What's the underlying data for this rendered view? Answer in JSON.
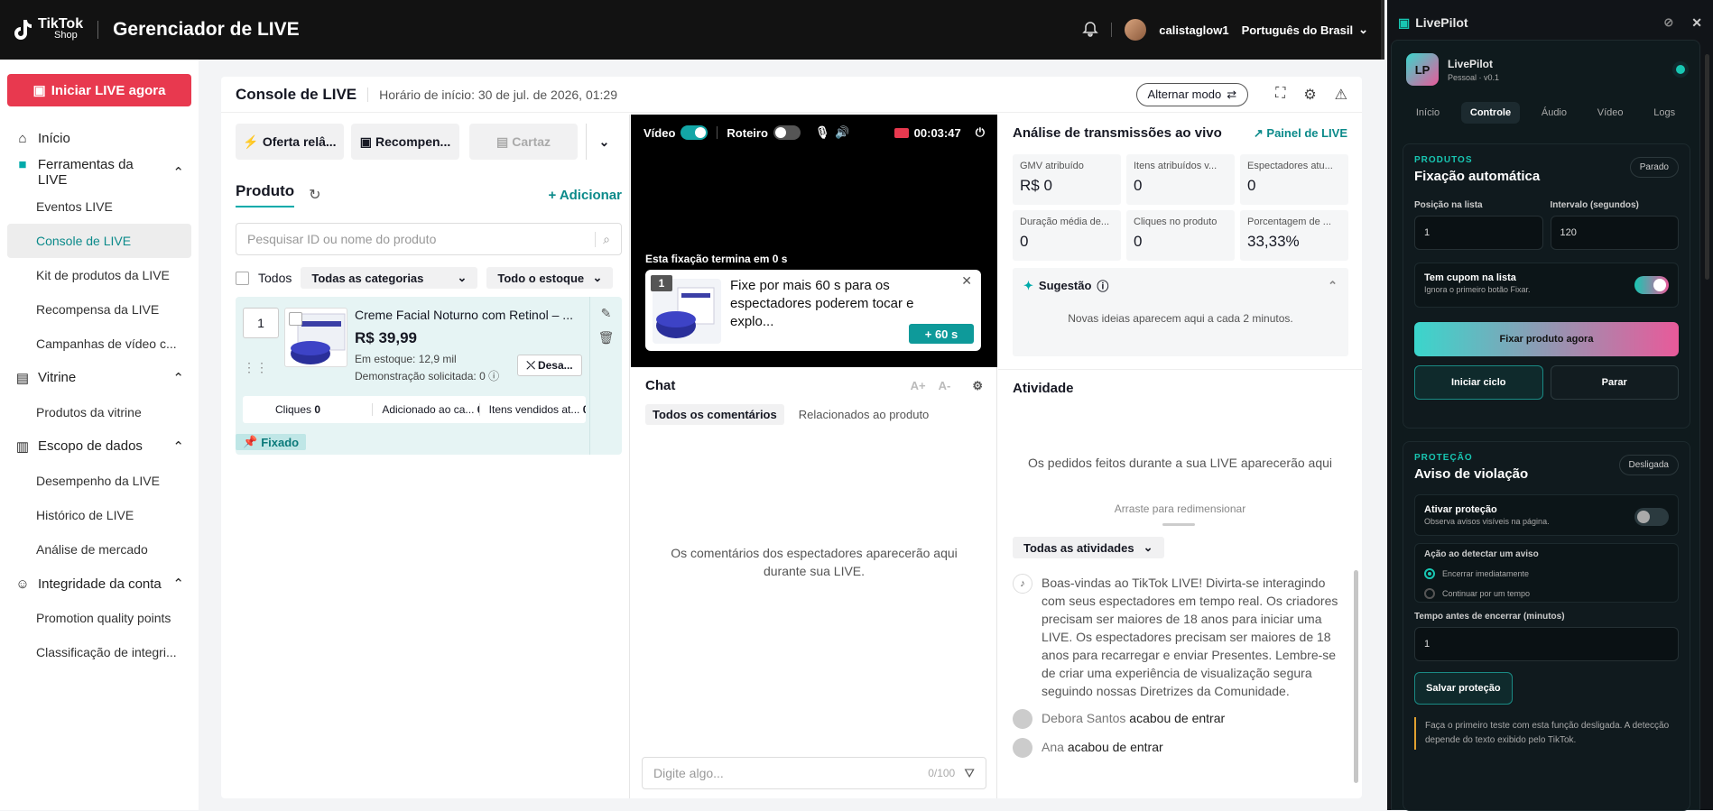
{
  "header": {
    "brand_top": "TikTok",
    "brand_bottom": "Shop",
    "title": "Gerenciador de LIVE",
    "username": "calistaglow1",
    "language": "Português do Brasil"
  },
  "sidebar": {
    "live_button": "Iniciar LIVE agora",
    "home": "Início",
    "groups": [
      {
        "label": "Ferramentas da LIVE",
        "items": [
          "Eventos LIVE",
          "Console de LIVE",
          "Kit de produtos da LIVE",
          "Recompensa da LIVE",
          "Campanhas de vídeo c..."
        ]
      },
      {
        "label": "Vitrine",
        "items": [
          "Produtos da vitrine"
        ]
      },
      {
        "label": "Escopo de dados",
        "items": [
          "Desempenho da LIVE",
          "Histórico de LIVE",
          "Análise de mercado"
        ]
      },
      {
        "label": "Integridade da conta",
        "items": [
          "Promotion quality points",
          "Classificação de integri..."
        ]
      }
    ]
  },
  "console": {
    "title": "Console de LIVE",
    "start_time": "Horário de início: 30 de jul. de 2026, 01:29",
    "mode_button": "Alternar modo"
  },
  "products": {
    "tools": [
      "Oferta relâ...",
      "Recompen...",
      "Cartaz"
    ],
    "tab": "Produto",
    "add": "Adicionar",
    "search_placeholder": "Pesquisar ID ou nome do produto",
    "all": "Todos",
    "category": "Todas as categorias",
    "stock": "Todo o estoque",
    "item": {
      "qty": "1",
      "name": "Creme Facial Noturno com Retinol – ...",
      "price": "R$ 39,99",
      "stock": "Em estoque: 12,9 mil",
      "demo": "Demonstração solicitada: 0",
      "unpin": "Desa...",
      "clicks_label": "Cliques",
      "clicks": "0",
      "added_label": "Adicionado ao ca...",
      "added": "0",
      "sold_label": "Itens vendidos at...",
      "sold": "0",
      "pinned": "Fixado"
    }
  },
  "video": {
    "video_label": "Vídeo",
    "script_label": "Roteiro",
    "timer": "00:03:47",
    "pin_ends": "Esta fixação termina em 0 s",
    "pin_index": "1",
    "pin_text": "Fixe por mais 60 s para os espectadores poderem tocar e explo...",
    "pin_plus": "+ 60 s"
  },
  "chat": {
    "title": "Chat",
    "font_up": "A+",
    "font_down": "A-",
    "tab_all": "Todos os comentários",
    "tab_product": "Relacionados ao produto",
    "empty": "Os comentários dos espectadores aparecerão aqui durante sua LIVE.",
    "input_placeholder": "Digite algo...",
    "counter": "0/100"
  },
  "analytics": {
    "title": "Análise de transmissões ao vivo",
    "panel_link": "Painel de LIVE",
    "metrics": [
      {
        "label": "GMV atribuído",
        "value": "R$ 0"
      },
      {
        "label": "Itens atribuídos v...",
        "value": "0"
      },
      {
        "label": "Espectadores atu...",
        "value": "0"
      },
      {
        "label": "Duração média de...",
        "value": "0"
      },
      {
        "label": "Cliques no produto",
        "value": "0"
      },
      {
        "label": "Porcentagem de ...",
        "value": "33,33%"
      }
    ],
    "suggestion_title": "Sugestão",
    "suggestion_body": "Novas ideias aparecem aqui a cada 2 minutos."
  },
  "activity": {
    "title": "Atividade",
    "empty": "Os pedidos feitos durante a sua LIVE aparecerão aqui",
    "drag": "Arraste para redimensionar",
    "filter": "Todas as atividades",
    "welcome": "Boas-vindas ao TikTok LIVE! Divirta-se interagindo com seus espectadores em tempo real. Os criadores precisam ser maiores de 18 anos para iniciar uma LIVE. Os espectadores precisam ser maiores de 18 anos para recarregar e enviar Presentes. Lembre-se de criar uma experiência de visualização segura seguindo nossas Diretrizes da Comunidade.",
    "joins": [
      {
        "user": "Debora Santos",
        "text": "acabou de entrar"
      },
      {
        "user": "Ana",
        "text": "acabou de entrar"
      }
    ]
  },
  "livepilot": {
    "window_title": "LivePilot",
    "app_name": "LivePilot",
    "app_sub": "Pessoal · v0.1",
    "logo": "LP",
    "tabs": [
      "Início",
      "Controle",
      "Áudio",
      "Vídeo",
      "Logs"
    ],
    "products_card": {
      "caption": "PRODUTOS",
      "title": "Fixação automática",
      "state": "Parado",
      "pos_label": "Posição na lista",
      "pos_value": "1",
      "interval_label": "Intervalo (segundos)",
      "interval_value": "120",
      "coupon_title": "Tem cupom na lista",
      "coupon_sub": "Ignora o primeiro botão Fixar.",
      "pin_now": "Fixar produto agora",
      "start": "Iniciar ciclo",
      "stop": "Parar"
    },
    "protection_card": {
      "caption": "PROTEÇÃO",
      "title": "Aviso de violação",
      "state": "Desligada",
      "enable_title": "Ativar proteção",
      "enable_sub": "Observa avisos visíveis na página.",
      "action_label": "Ação ao detectar um aviso",
      "opt1": "Encerrar imediatamente",
      "opt2": "Continuar por um tempo",
      "time_label": "Tempo antes de encerrar (minutos)",
      "time_value": "1",
      "save": "Salvar proteção",
      "note": "Faça o primeiro teste com esta função desligada. A detecção depende do texto exibido pelo TikTok."
    }
  }
}
